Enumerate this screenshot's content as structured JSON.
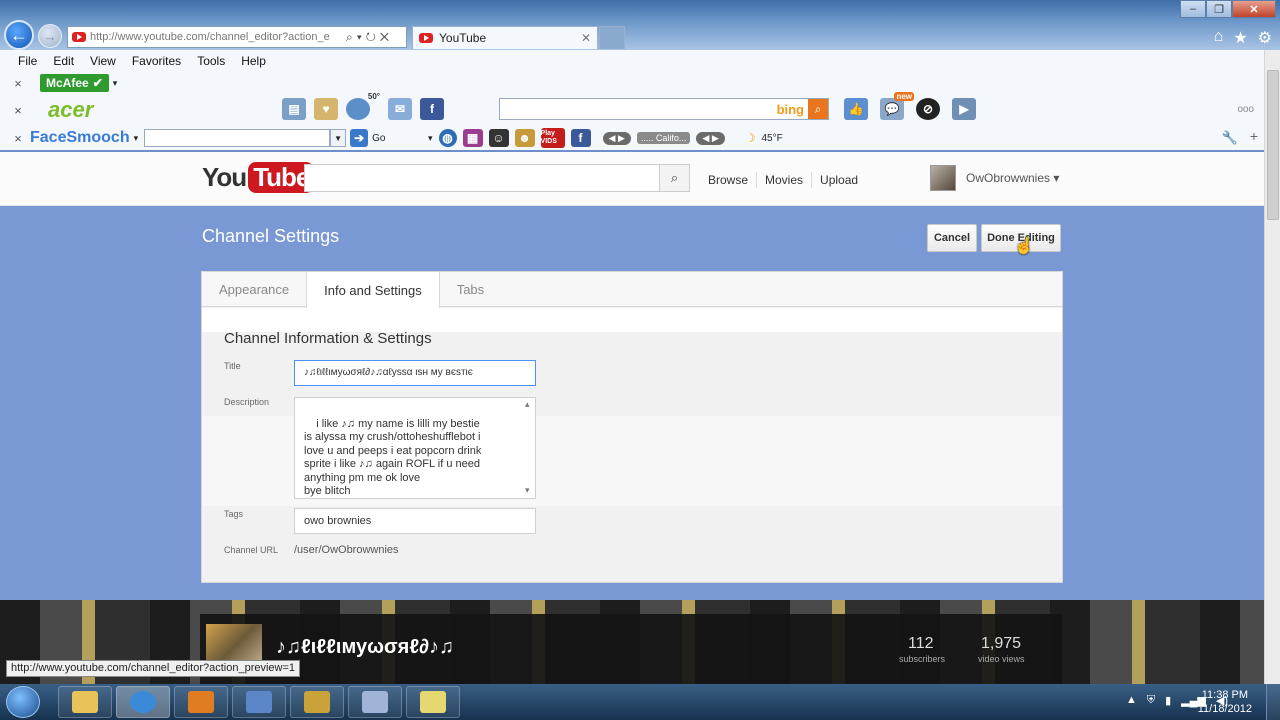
{
  "browser": {
    "address": "http://www.youtube.com/channel_editor?action_e",
    "address_host": "youtube.com",
    "tab_title": "YouTube",
    "menu": [
      "File",
      "Edit",
      "View",
      "Favorites",
      "Tools",
      "Help"
    ],
    "mcafee_label": "McAfee",
    "acer_label": "acer",
    "bing_label": "bing",
    "new_badge": "new",
    "weather_temp": "50°",
    "facesmooch_label": "FaceSmooch",
    "go_label": "Go",
    "playvids_label": "Play VIDS",
    "location_label": "..... Califo...",
    "temperature": "45°F",
    "status_url": "http://www.youtube.com/channel_editor?action_preview=1"
  },
  "youtube": {
    "logo_you": "You",
    "logo_tube": "Tube",
    "nav": [
      "Browse",
      "Movies",
      "Upload"
    ],
    "username": "OwObrowwnies ▾"
  },
  "settings": {
    "page_title": "Channel Settings",
    "cancel_label": "Cancel",
    "done_label": "Done Editing",
    "tabs": [
      "Appearance",
      "Info and Settings",
      "Tabs"
    ],
    "active_tab": "Info and Settings",
    "section_title": "Channel Information & Settings",
    "title_label": "Title",
    "title_value": "♪♫ℓιℓℓιмуωσяℓ∂♪♫αℓуѕѕα ιѕн му вєѕтιє",
    "description_label": "Description",
    "description_value": "i like ♪♫ my name is lilli my bestie\nis alyssa my crush/ottoheshufflebot i\nlove u and peeps i eat popcorn drink\nsprite i like ♪♫ again ROFL if u need\nanything pm me ok love\nbye blitch",
    "tags_label": "Tags",
    "tags_value": "owo brownies",
    "url_label": "Channel URL",
    "url_value": "/user/OwObrowwnies"
  },
  "channel": {
    "name": "♪♫ℓιℓℓιмуωσяℓ∂♪♫",
    "subscribers": "112",
    "subscribers_label": "subscribers",
    "views": "1,975",
    "views_label": "video views"
  },
  "taskbar": {
    "time": "11:38 PM",
    "date": "11/18/2012"
  }
}
